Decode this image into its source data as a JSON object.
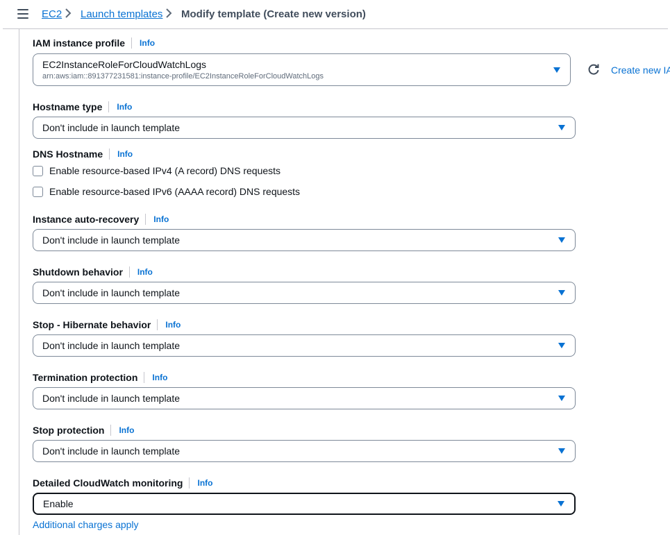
{
  "breadcrumb": {
    "items": [
      "EC2",
      "Launch templates"
    ],
    "current": "Modify template (Create new version)"
  },
  "info_label": "Info",
  "iam_profile": {
    "label": "IAM instance profile",
    "value": "EC2InstanceRoleForCloudWatchLogs",
    "arn": "arn:aws:iam::891377231581:instance-profile/EC2InstanceRoleForCloudWatchLogs",
    "create_link": "Create new IA"
  },
  "hostname_type": {
    "label": "Hostname type",
    "value": "Don't include in launch template"
  },
  "dns_hostname": {
    "label": "DNS Hostname",
    "options": [
      {
        "label": "Enable resource-based IPv4 (A record) DNS requests",
        "checked": false
      },
      {
        "label": "Enable resource-based IPv6 (AAAA record) DNS requests",
        "checked": false
      }
    ]
  },
  "auto_recovery": {
    "label": "Instance auto-recovery",
    "value": "Don't include in launch template"
  },
  "shutdown": {
    "label": "Shutdown behavior",
    "value": "Don't include in launch template"
  },
  "hibernate": {
    "label": "Stop - Hibernate behavior",
    "value": "Don't include in launch template"
  },
  "termination": {
    "label": "Termination protection",
    "value": "Don't include in launch template"
  },
  "stop_protection": {
    "label": "Stop protection",
    "value": "Don't include in launch template"
  },
  "cloudwatch": {
    "label": "Detailed CloudWatch monitoring",
    "value": "Enable",
    "note": "Additional charges apply"
  },
  "colors": {
    "link": "#0972d3",
    "text": "#0f141a",
    "border": "#7d8998",
    "muted": "#5f6b7a"
  }
}
